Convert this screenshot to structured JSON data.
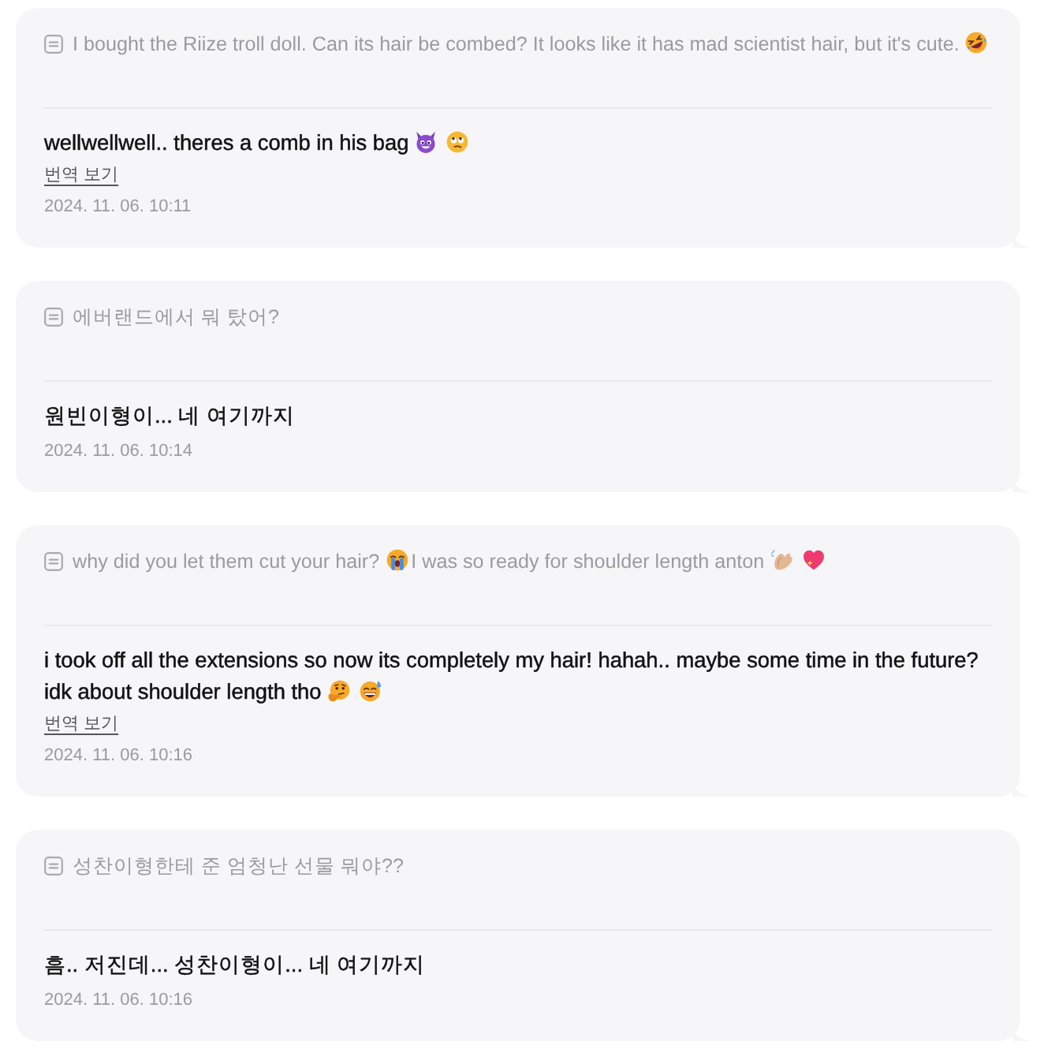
{
  "messages": [
    {
      "question": {
        "parts": [
          {
            "kind": "text",
            "text": "I bought the Riize troll doll. Can its hair be combed? It looks like it has mad scientist hair, but it's cute."
          },
          {
            "kind": "rofl"
          }
        ]
      },
      "answer": {
        "parts": [
          {
            "kind": "text",
            "text": "wellwellwell.. theres a comb in his bag"
          },
          {
            "kind": "devil"
          },
          {
            "kind": "eyeroll"
          }
        ]
      },
      "translate_link": "번역 보기",
      "timestamp": "2024. 11. 06. 10:11"
    },
    {
      "question": {
        "parts": [
          {
            "kind": "text",
            "text": "에버랜드에서 뭐 탔어?"
          }
        ]
      },
      "answer": {
        "parts": [
          {
            "kind": "text",
            "text": "원빈이형이... 네 여기까지"
          }
        ]
      },
      "timestamp": "2024. 11. 06. 10:14"
    },
    {
      "question": {
        "parts": [
          {
            "kind": "text",
            "text": "why did you let them cut your hair?"
          },
          {
            "kind": "crying"
          },
          {
            "kind": "text",
            "text": "I was so ready for shoulder length anton"
          },
          {
            "kind": "clap"
          },
          {
            "kind": "heart"
          }
        ]
      },
      "answer": {
        "parts": [
          {
            "kind": "text",
            "text": "i took off all the extensions so now its completely my hair! hahah.. maybe some time in the future?"
          },
          {
            "kind": "text",
            "text": "idk about shoulder length tho"
          },
          {
            "kind": "thinking"
          },
          {
            "kind": "sweatsmile"
          }
        ]
      },
      "translate_link": "번역 보기",
      "timestamp": "2024. 11. 06. 10:16"
    },
    {
      "question": {
        "parts": [
          {
            "kind": "text",
            "text": "성찬이형한테 준 엄청난 선물 뭐야??"
          }
        ]
      },
      "answer": {
        "parts": [
          {
            "kind": "text",
            "text": "흠.. 저진데... 성찬이형이... 네 여기까지"
          }
        ]
      },
      "timestamp": "2024. 11. 06. 10:16"
    }
  ]
}
